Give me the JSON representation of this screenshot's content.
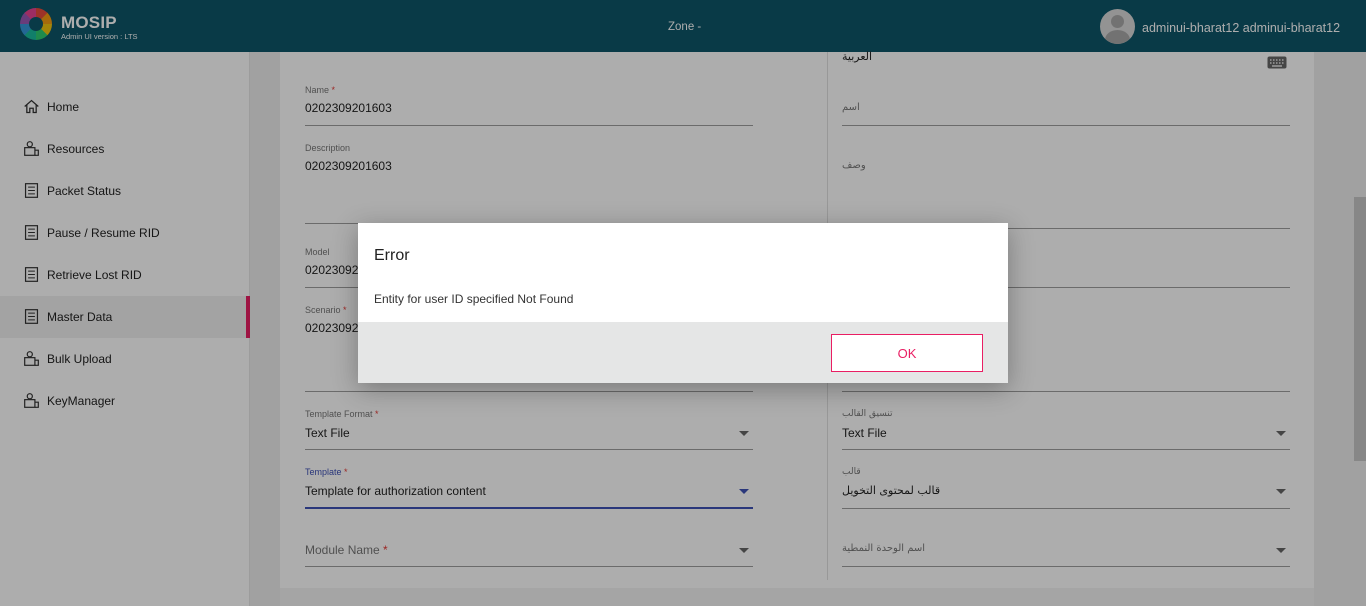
{
  "header": {
    "brand": "MOSIP",
    "version": "Admin UI version : LTS",
    "zone": "Zone -",
    "user": "adminui-bharat12 adminui-bharat12"
  },
  "sidebar": {
    "items": [
      {
        "label": "Home",
        "icon": "home-icon"
      },
      {
        "label": "Resources",
        "icon": "resources-icon"
      },
      {
        "label": "Packet Status",
        "icon": "list-icon"
      },
      {
        "label": "Pause / Resume RID",
        "icon": "list-icon"
      },
      {
        "label": "Retrieve Lost RID",
        "icon": "list-icon"
      },
      {
        "label": "Master Data",
        "icon": "list-icon",
        "active": true
      },
      {
        "label": "Bulk Upload",
        "icon": "upload-icon"
      },
      {
        "label": "KeyManager",
        "icon": "key-icon"
      }
    ]
  },
  "form_left": {
    "name_label": "Name",
    "name_value": "0202309201603",
    "description_label": "Description",
    "description_value": "0202309201603",
    "model_label": "Model",
    "model_value": "02023092",
    "scenario_label": "Scenario",
    "scenario_value": "02023092",
    "template_format_label": "Template Format",
    "template_format_value": "Text File",
    "template_label": "Template",
    "template_value": "Template for authorization content",
    "module_name_label": "Module Name",
    "required_mark": "*"
  },
  "form_right": {
    "language": "العربية",
    "name_placeholder": "اسم",
    "description_placeholder": "وصف",
    "template_format_label": "تنسيق القالب",
    "template_format_value": "Text File",
    "template_label": "قالب",
    "template_value": "قالب لمحتوى التخويل",
    "module_name_placeholder": "اسم الوحدة النمطية"
  },
  "dialog": {
    "title": "Error",
    "message": "Entity for user ID specified Not Found",
    "ok_label": "OK"
  },
  "colors": {
    "header": "#0e5669",
    "accent": "#e91e63",
    "focused_field": "#3f51b5"
  }
}
